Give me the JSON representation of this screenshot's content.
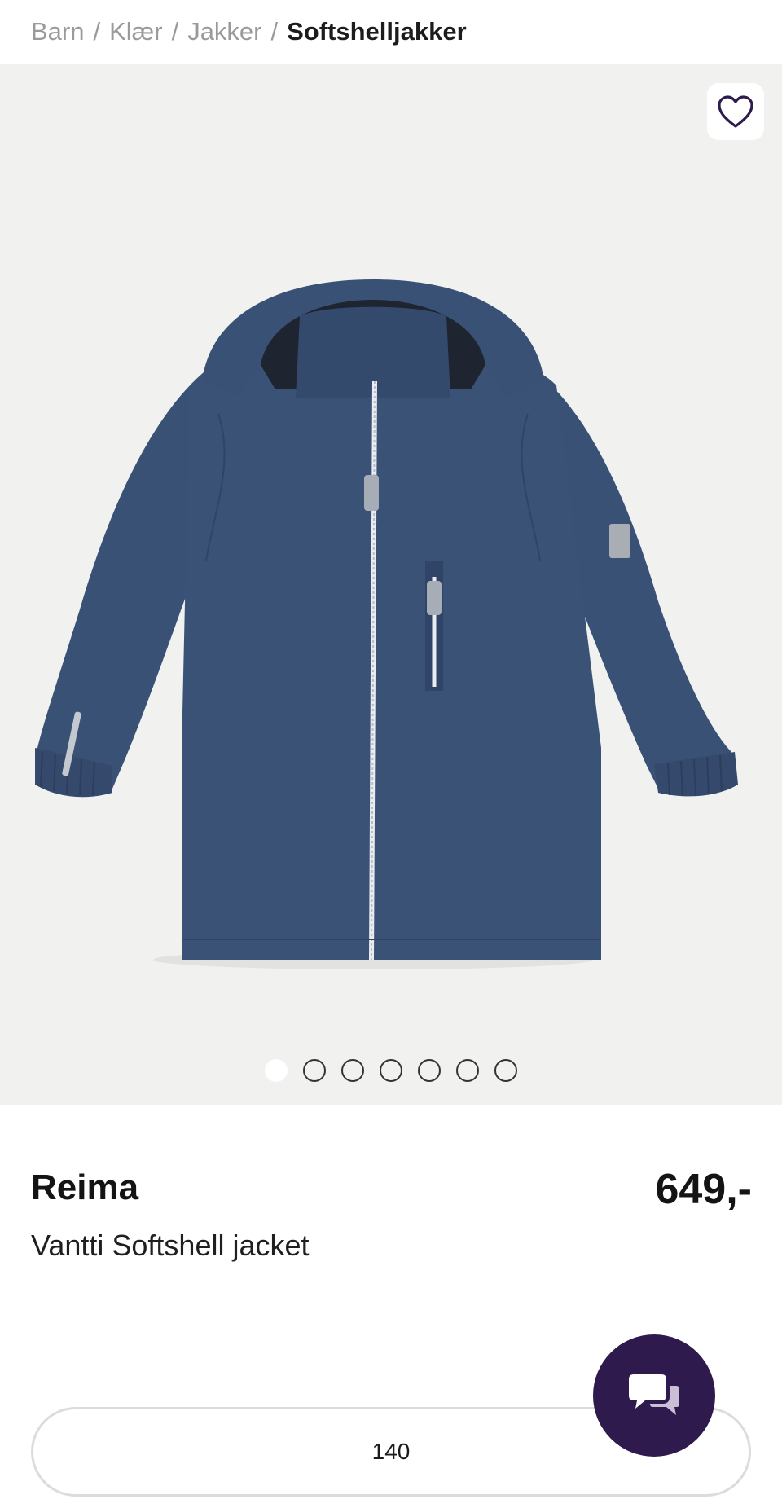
{
  "breadcrumb": {
    "items": [
      "Barn",
      "Klær",
      "Jakker"
    ],
    "separator": "/",
    "current": "Softshelljakker"
  },
  "gallery": {
    "image_count": 7,
    "active_index": 0,
    "favorite_icon": "heart-outline-icon"
  },
  "product": {
    "brand": "Reima",
    "name": "Vantti Softshell jacket",
    "price": "649,-"
  },
  "size_selector": {
    "value": "140"
  },
  "chat": {
    "icon": "chat-bubbles-icon",
    "color": "#2e1a4c"
  },
  "colors": {
    "jacket": "#3a5176",
    "gallery_bg": "#f1f1f0"
  }
}
